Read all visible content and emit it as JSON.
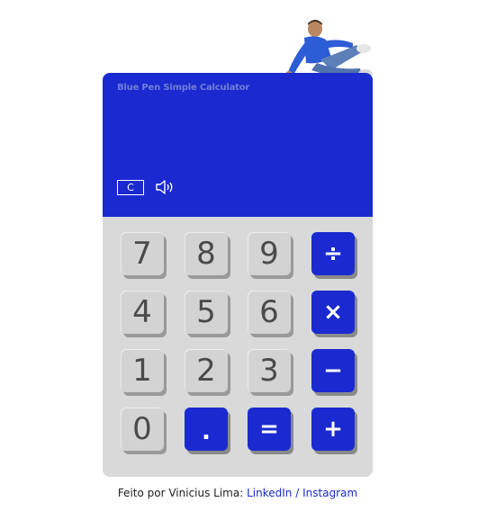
{
  "app": {
    "title": "Blue Pen Simple Calculator",
    "mascot_icon": "seated-man-photo"
  },
  "controls": {
    "clear_label": "C",
    "sound_icon": "speaker-icon"
  },
  "keys": {
    "k7": "7",
    "k8": "8",
    "k9": "9",
    "divide": "÷",
    "k4": "4",
    "k5": "5",
    "k6": "6",
    "multiply": "×",
    "k1": "1",
    "k2": "2",
    "k3": "3",
    "minus": "−",
    "k0": "0",
    "dot": ".",
    "equals": "=",
    "plus": "+"
  },
  "footer": {
    "text": "Feito por Vinicius Lima:",
    "linkedin": "LinkedIn",
    "separator": "/",
    "instagram": "Instagram"
  },
  "colors": {
    "accent": "#1a2ad0",
    "key_gray": "#d3d3d3",
    "body_gray": "#d9d9d9"
  }
}
